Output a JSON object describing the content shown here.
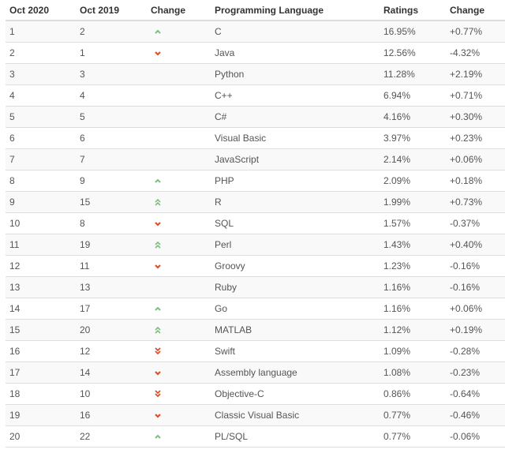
{
  "colors": {
    "up": "#7cbf7c",
    "down": "#e0502a"
  },
  "table": {
    "headers": [
      "Oct 2020",
      "Oct 2019",
      "Change",
      "Programming Language",
      "Ratings",
      "Change"
    ],
    "rows": [
      {
        "rank_2020": "1",
        "rank_2019": "2",
        "trend": "up",
        "language": "C",
        "rating": "16.95%",
        "change": "+0.77%"
      },
      {
        "rank_2020": "2",
        "rank_2019": "1",
        "trend": "down",
        "language": "Java",
        "rating": "12.56%",
        "change": "-4.32%"
      },
      {
        "rank_2020": "3",
        "rank_2019": "3",
        "trend": "none",
        "language": "Python",
        "rating": "11.28%",
        "change": "+2.19%"
      },
      {
        "rank_2020": "4",
        "rank_2019": "4",
        "trend": "none",
        "language": "C++",
        "rating": "6.94%",
        "change": "+0.71%"
      },
      {
        "rank_2020": "5",
        "rank_2019": "5",
        "trend": "none",
        "language": "C#",
        "rating": "4.16%",
        "change": "+0.30%"
      },
      {
        "rank_2020": "6",
        "rank_2019": "6",
        "trend": "none",
        "language": "Visual Basic",
        "rating": "3.97%",
        "change": "+0.23%"
      },
      {
        "rank_2020": "7",
        "rank_2019": "7",
        "trend": "none",
        "language": "JavaScript",
        "rating": "2.14%",
        "change": "+0.06%"
      },
      {
        "rank_2020": "8",
        "rank_2019": "9",
        "trend": "up",
        "language": "PHP",
        "rating": "2.09%",
        "change": "+0.18%"
      },
      {
        "rank_2020": "9",
        "rank_2019": "15",
        "trend": "up-double",
        "language": "R",
        "rating": "1.99%",
        "change": "+0.73%"
      },
      {
        "rank_2020": "10",
        "rank_2019": "8",
        "trend": "down",
        "language": "SQL",
        "rating": "1.57%",
        "change": "-0.37%"
      },
      {
        "rank_2020": "11",
        "rank_2019": "19",
        "trend": "up-double",
        "language": "Perl",
        "rating": "1.43%",
        "change": "+0.40%"
      },
      {
        "rank_2020": "12",
        "rank_2019": "11",
        "trend": "down",
        "language": "Groovy",
        "rating": "1.23%",
        "change": "-0.16%"
      },
      {
        "rank_2020": "13",
        "rank_2019": "13",
        "trend": "none",
        "language": "Ruby",
        "rating": "1.16%",
        "change": "-0.16%"
      },
      {
        "rank_2020": "14",
        "rank_2019": "17",
        "trend": "up",
        "language": "Go",
        "rating": "1.16%",
        "change": "+0.06%"
      },
      {
        "rank_2020": "15",
        "rank_2019": "20",
        "trend": "up-double",
        "language": "MATLAB",
        "rating": "1.12%",
        "change": "+0.19%"
      },
      {
        "rank_2020": "16",
        "rank_2019": "12",
        "trend": "down-double",
        "language": "Swift",
        "rating": "1.09%",
        "change": "-0.28%"
      },
      {
        "rank_2020": "17",
        "rank_2019": "14",
        "trend": "down",
        "language": "Assembly language",
        "rating": "1.08%",
        "change": "-0.23%"
      },
      {
        "rank_2020": "18",
        "rank_2019": "10",
        "trend": "down-double",
        "language": "Objective-C",
        "rating": "0.86%",
        "change": "-0.64%"
      },
      {
        "rank_2020": "19",
        "rank_2019": "16",
        "trend": "down",
        "language": "Classic Visual Basic",
        "rating": "0.77%",
        "change": "-0.46%"
      },
      {
        "rank_2020": "20",
        "rank_2019": "22",
        "trend": "up",
        "language": "PL/SQL",
        "rating": "0.77%",
        "change": "-0.06%"
      }
    ]
  }
}
